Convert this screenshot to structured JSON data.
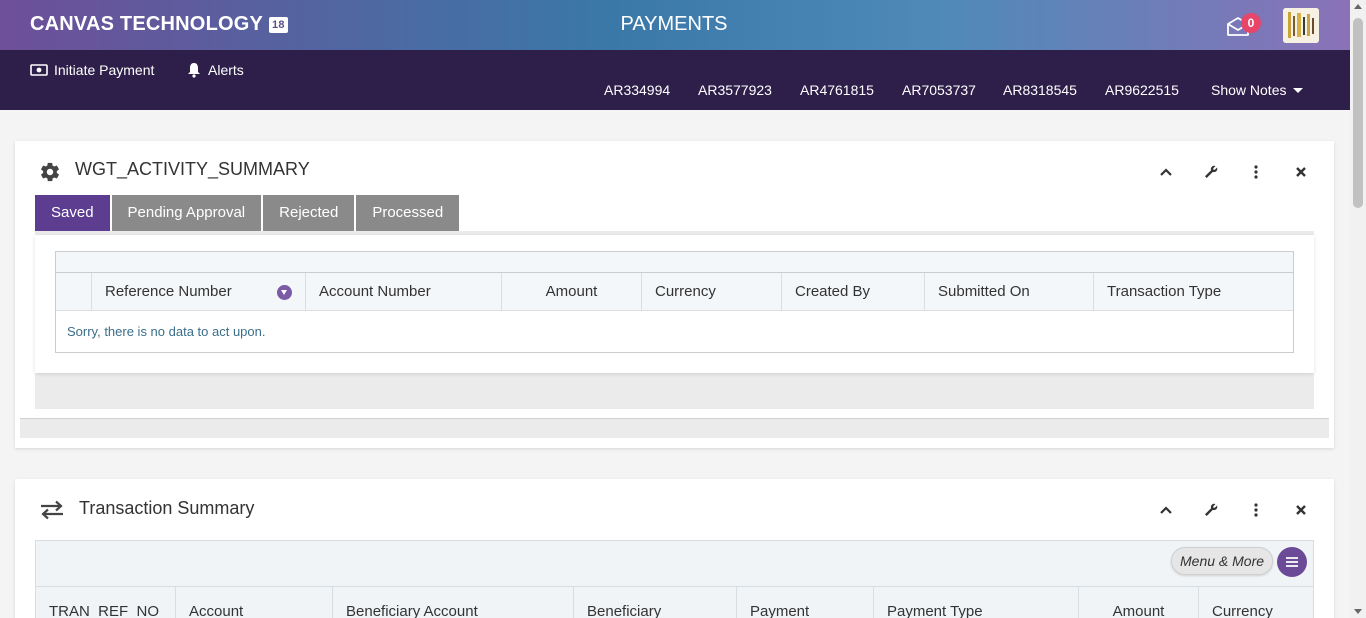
{
  "header": {
    "brand": "CANVAS TECHNOLOGY",
    "brand_badge": "18",
    "title": "PAYMENTS",
    "mail_count": "0",
    "colors": {
      "nav_bg": "#2e1f4a",
      "active_tab": "#5c3d8f",
      "badge": "#e8456a"
    }
  },
  "nav": {
    "initiate_payment": "Initiate Payment",
    "alerts": "Alerts",
    "accounts": [
      "AR334994",
      "AR3577923",
      "AR4761815",
      "AR7053737",
      "AR8318545",
      "AR9622515"
    ],
    "show_notes": "Show Notes"
  },
  "widget1": {
    "title": "WGT_ACTIVITY_SUMMARY",
    "tabs": [
      "Saved",
      "Pending Approval",
      "Rejected",
      "Processed"
    ],
    "columns": [
      "Reference Number",
      "Account Number",
      "Amount",
      "Currency",
      "Created By",
      "Submitted On",
      "Transaction Type"
    ],
    "empty_message": "Sorry, there is no data to act upon."
  },
  "widget2": {
    "title": "Transaction Summary",
    "menu_more": "Menu & More",
    "columns": [
      "TRAN_REF_NO",
      "Account",
      "Beneficiary Account",
      "Beneficiary",
      "Payment",
      "Payment Type",
      "Amount",
      "Currency"
    ]
  }
}
